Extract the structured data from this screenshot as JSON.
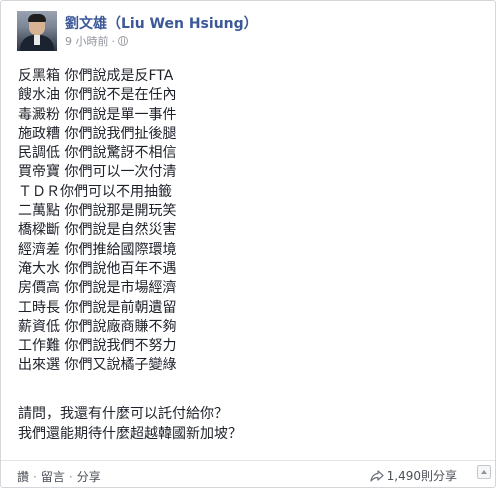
{
  "post": {
    "author": "劉文雄（Liu Wen Hsiung）",
    "timestamp": "9 小時前",
    "meta_separator": "·",
    "privacy_icon": "globe-icon",
    "lines": [
      "反黑箱 你們說成是反FTA",
      "餿水油 你們說不是在任內",
      "毒澱粉 你們說是單一事件",
      "施政糟 你們說我們扯後腿",
      "民調低 你們說驚訝不相信",
      "買帝寶 你們可以一次付清",
      "ＴＤＲ你們可以不用抽籤",
      "二萬點 你們說那是開玩笑",
      "橋樑斷 你們說是自然災害",
      "經濟差 你們推給國際環境",
      "淹大水 你們說他百年不遇",
      "房價高 你們說是市場經濟",
      "工時長 你們說是前朝遺留",
      "薪資低 你們說廠商賺不夠",
      "工作難 你們說我們不努力",
      "出來選 你們又說橘子變綠"
    ],
    "closing": [
      "請問，我還有什麼可以託付給你？",
      "我們還能期待什麼超越韓國新加坡？"
    ]
  },
  "footer": {
    "like": "讚",
    "comment": "留言",
    "share": "分享",
    "separator": "·",
    "share_count": "1,490則分享",
    "share_icon": "share-arrow-icon"
  },
  "colors": {
    "author_link": "#3b5998",
    "text": "#1d2129",
    "meta": "#90949c",
    "border": "#d3d6db"
  }
}
